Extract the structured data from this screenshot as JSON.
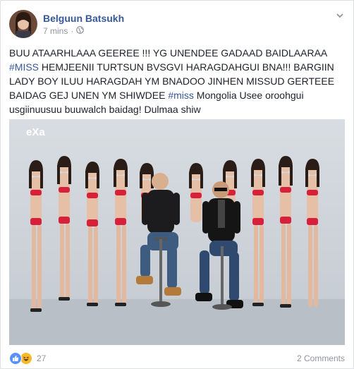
{
  "post": {
    "author": "Belguun Batsukh",
    "time": "7 mins",
    "separator": "·",
    "text_parts": [
      "BUU ATAARHLAAA GEEREE !!! YG UNENDEE GADAAD BAIDLAARAA ",
      "#MISS",
      " HEMJEENII TURTSUN BVSGVI HARAGDAHGUI BNA!!! BARGIIN LADY BOY ILUU HARAGDAH YM BNADOO JINHEN MISSUD GERTEEE BAIDAG GEJ UNEN YM SHIWDEE ",
      "#miss",
      " Mongolia Usee oroohgui usgiinuusuu buuwalch baidag! Dulmaa shiw"
    ],
    "photo_logo": "eXa"
  },
  "footer": {
    "reaction_count": "27",
    "comments": "2 Comments"
  },
  "colors": {
    "link": "#365899",
    "meta": "#90949c",
    "text": "#1d2129",
    "like": "#5890ff",
    "haha": "#f7b928"
  },
  "icons": [
    "globe-icon",
    "chevron-down-icon",
    "like-reaction-icon",
    "haha-reaction-icon"
  ]
}
